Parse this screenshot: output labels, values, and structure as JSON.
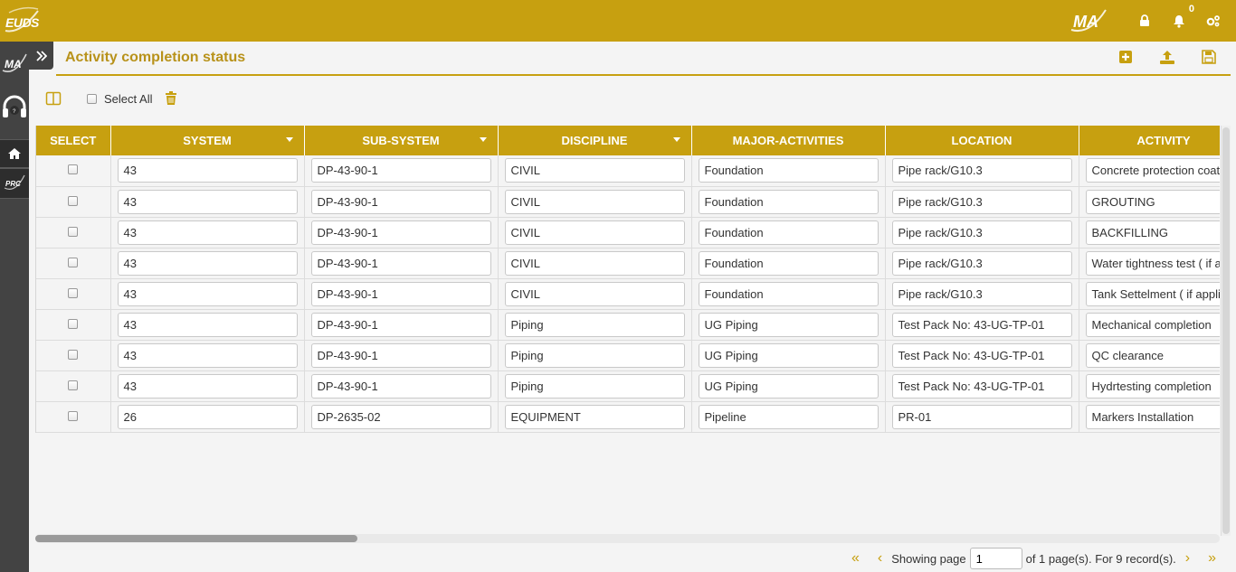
{
  "app": {
    "brand": "EUDS",
    "module_logo": "MA",
    "notification_count": "0"
  },
  "rail": {
    "items": [
      "MA",
      "support",
      "home",
      "PRC"
    ]
  },
  "page": {
    "title": "Activity completion status"
  },
  "toolbar": {
    "select_all_label": "Select All"
  },
  "grid": {
    "columns": [
      "SELECT",
      "SYSTEM",
      "SUB-SYSTEM",
      "DISCIPLINE",
      "MAJOR-ACTIVITIES",
      "LOCATION",
      "ACTIVITY"
    ],
    "rows": [
      {
        "system": "43",
        "subsystem": "DP-43-90-1",
        "discipline": "CIVIL",
        "major": "Foundation",
        "location": "Pipe rack/G10.3",
        "activity": "Concrete protection coati"
      },
      {
        "system": "43",
        "subsystem": "DP-43-90-1",
        "discipline": "CIVIL",
        "major": "Foundation",
        "location": "Pipe rack/G10.3",
        "activity": "GROUTING"
      },
      {
        "system": "43",
        "subsystem": "DP-43-90-1",
        "discipline": "CIVIL",
        "major": "Foundation",
        "location": "Pipe rack/G10.3",
        "activity": "BACKFILLING"
      },
      {
        "system": "43",
        "subsystem": "DP-43-90-1",
        "discipline": "CIVIL",
        "major": "Foundation",
        "location": "Pipe rack/G10.3",
        "activity": "Water tightness test ( if a"
      },
      {
        "system": "43",
        "subsystem": "DP-43-90-1",
        "discipline": "CIVIL",
        "major": "Foundation",
        "location": "Pipe rack/G10.3",
        "activity": "Tank Settelment ( if appli"
      },
      {
        "system": "43",
        "subsystem": "DP-43-90-1",
        "discipline": "Piping",
        "major": "UG Piping",
        "location": "Test Pack No: 43-UG-TP-01",
        "activity": "Mechanical completion"
      },
      {
        "system": "43",
        "subsystem": "DP-43-90-1",
        "discipline": "Piping",
        "major": "UG Piping",
        "location": "Test Pack No: 43-UG-TP-01",
        "activity": "QC clearance"
      },
      {
        "system": "43",
        "subsystem": "DP-43-90-1",
        "discipline": "Piping",
        "major": "UG Piping",
        "location": "Test Pack No: 43-UG-TP-01",
        "activity": "Hydrtesting completion"
      },
      {
        "system": "26",
        "subsystem": "DP-2635-02",
        "discipline": "EQUIPMENT",
        "major": "Pipeline",
        "location": "PR-01",
        "activity": "Markers Installation"
      }
    ]
  },
  "pager": {
    "prefix": "Showing page",
    "page": "1",
    "suffix": "of 1 page(s). For 9 record(s)."
  },
  "colors": {
    "accent": "#c7a010",
    "rail": "#434343"
  }
}
